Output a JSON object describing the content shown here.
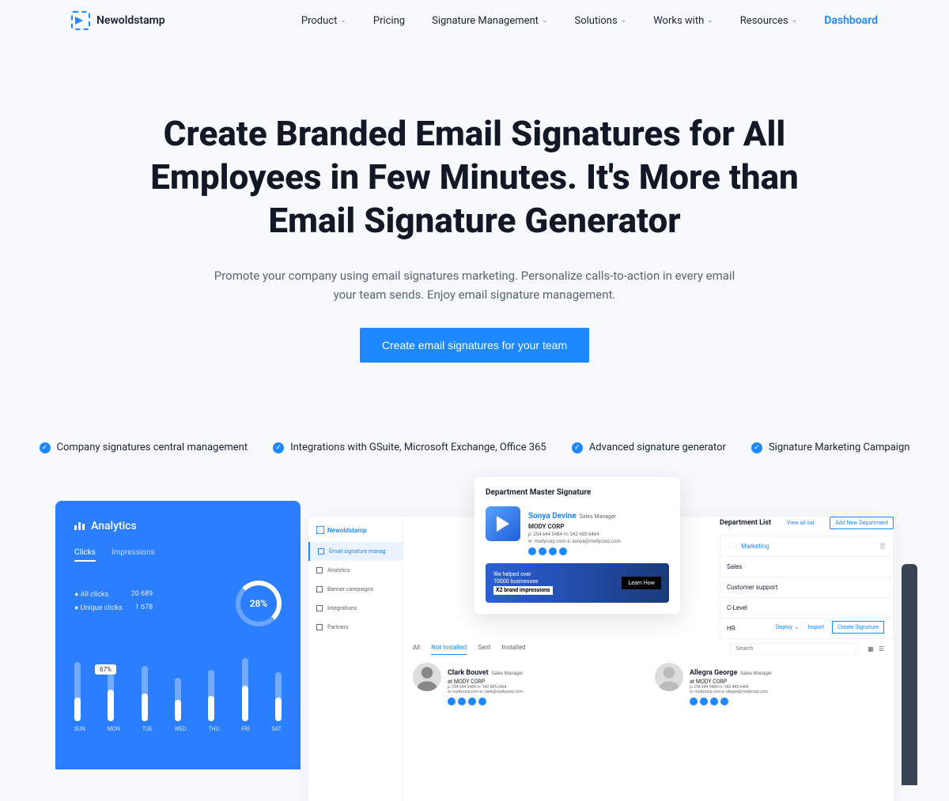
{
  "brand": "Newoldstamp",
  "nav": {
    "items": [
      {
        "label": "Product",
        "dropdown": true
      },
      {
        "label": "Pricing",
        "dropdown": false
      },
      {
        "label": "Signature Management",
        "dropdown": true
      },
      {
        "label": "Solutions",
        "dropdown": true
      },
      {
        "label": "Works with",
        "dropdown": true
      },
      {
        "label": "Resources",
        "dropdown": true
      }
    ],
    "dashboard": "Dashboard"
  },
  "hero": {
    "title": "Create Branded Email Signatures for All Employees in Few Minutes. It's More than Email Signature Generator",
    "subtitle": "Promote your company using email signatures marketing. Personalize calls-to-action in every email your team sends. Enjoy email signature management.",
    "cta": "Create email signatures for your team"
  },
  "features": [
    "Company signatures central management",
    "Integrations with GSuite, Microsoft Exchange, Office 365",
    "Advanced signature generator",
    "Signature Marketing Campaign"
  ],
  "analytics": {
    "title": "Analytics",
    "tabs": [
      "Clicks",
      "Impressions"
    ],
    "stats": [
      {
        "label": "All clicks",
        "value": "20 689"
      },
      {
        "label": "Unique clicks",
        "value": "1 678"
      }
    ],
    "donut": "28%",
    "tooltip": "67%",
    "days": [
      "SUN",
      "MON",
      "TUE",
      "WED",
      "THU",
      "FRI",
      "SAT"
    ],
    "bars": [
      75,
      60,
      70,
      55,
      65,
      80,
      62
    ],
    "fills": [
      30,
      40,
      35,
      28,
      32,
      45,
      30
    ]
  },
  "sidebar": {
    "brand": "Newoldstamp",
    "items": [
      "Email signature manag",
      "Analytics",
      "Banner campaigns",
      "Integrations",
      "Partners"
    ]
  },
  "dept_card": {
    "title": "Department Master Signature",
    "name": "Sonya Devine",
    "role": "Sales Manager",
    "company": "MODY CORP",
    "phone1": "p: 254 644 5484",
    "phone2": "m: 542 485 6464",
    "web": "w: modycorp.com",
    "email": "e: sonya@modycorp.com",
    "banner_line1": "We helped over",
    "banner_line2": "10000 businesses",
    "banner_line3": "X2 brand impressions",
    "banner_cta": "Learn How"
  },
  "dept_list": {
    "title": "Department List",
    "view_all": "View all list",
    "add_btn": "Add New Department",
    "items": [
      "Marketing",
      "Sales",
      "Customer support",
      "C-Level",
      "HR"
    ]
  },
  "actions": {
    "deploy": "Deploy",
    "import": "Import",
    "create": "Create Signature"
  },
  "filters": {
    "items": [
      "All",
      "Not Installed",
      "Sent",
      "Installed"
    ],
    "search_placeholder": "Search"
  },
  "employees": [
    {
      "name": "Clark Bouvet",
      "role": "Sales Manager",
      "company": "at MODY CORP",
      "contact": "p: 254 644 5484 m: 542 485 6464",
      "web": "w: modycorp.com e: clark@modycorp.com"
    },
    {
      "name": "Allegra George",
      "role": "Sales Manager",
      "company": "at MODY CORP",
      "contact": "p: 254 644 5484 m: 542 485 6464",
      "web": "w: modycorp.com e: allegra@modycorp.com"
    }
  ]
}
